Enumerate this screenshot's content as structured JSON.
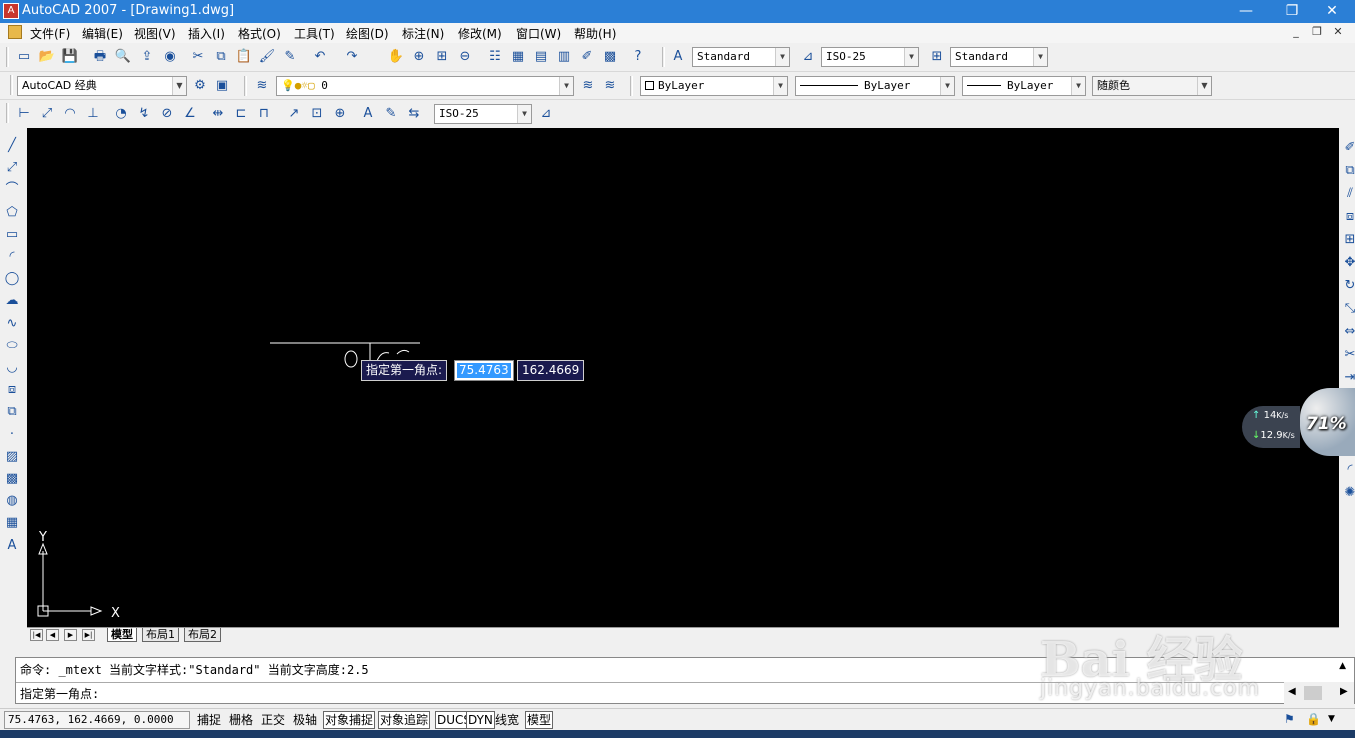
{
  "titlebar": {
    "title": "AutoCAD 2007 - [Drawing1.dwg]",
    "minimize": "—",
    "maximize": "❐",
    "close": "✕"
  },
  "menu": [
    "文件(F)",
    "编辑(E)",
    "视图(V)",
    "插入(I)",
    "格式(O)",
    "工具(T)",
    "绘图(D)",
    "标注(N)",
    "修改(M)",
    "窗口(W)",
    "帮助(H)"
  ],
  "mdi": {
    "minimize": "_",
    "restore": "❐",
    "close": "✕"
  },
  "toolbars": {
    "text_style": "Standard",
    "dim_style": "ISO-25",
    "table_style": "Standard",
    "workspace": "AutoCAD 经典",
    "layer": "0",
    "color": "ByLayer",
    "linetype": "ByLayer",
    "lineweight": "ByLayer",
    "plotstyle": "随颜色",
    "dim_style2": "ISO-25"
  },
  "icons": {
    "std": [
      "new-icon",
      "open-icon",
      "save-icon",
      "plot-icon",
      "preview-icon",
      "publish-icon",
      "3d-publish-icon",
      "cut-icon",
      "copy-icon",
      "paste-icon",
      "match-prop-icon",
      "block-edit-icon",
      "undo-icon",
      "redo-icon",
      "pan-icon",
      "zoom-realtime-icon",
      "zoom-window-icon",
      "zoom-previous-icon",
      "properties-icon",
      "design-center-icon",
      "tool-palettes-icon",
      "sheet-set-icon",
      "markup-icon",
      "calculator-icon",
      "help-icon"
    ],
    "draw": [
      "line-icon",
      "construction-line-icon",
      "polyline-icon",
      "polygon-icon",
      "rectangle-icon",
      "arc-icon",
      "circle-icon",
      "revision-cloud-icon",
      "spline-icon",
      "ellipse-icon",
      "ellipse-arc-icon",
      "insert-block-icon",
      "make-block-icon",
      "point-icon",
      "hatch-icon",
      "gradient-icon",
      "region-icon",
      "table-icon",
      "multiline-text-icon"
    ],
    "modify": [
      "erase-icon",
      "copy-object-icon",
      "mirror-icon",
      "offset-icon",
      "array-icon",
      "move-icon",
      "rotate-icon",
      "scale-icon",
      "stretch-icon",
      "trim-icon",
      "extend-icon",
      "break-icon",
      "join-icon",
      "chamfer-icon",
      "fillet-icon",
      "explode-icon"
    ]
  },
  "drawing": {
    "ucs_y": "Y",
    "ucs_x": "X",
    "dyn_prompt": "指定第一角点:",
    "dyn_x": "75.4763",
    "dyn_y": "162.4669"
  },
  "tabs": [
    "模型",
    "布局1",
    "布局2"
  ],
  "command": {
    "history": "命令: _mtext 当前文字样式:\"Standard\"  当前文字高度:2.5",
    "prompt": "指定第一角点:"
  },
  "status": {
    "coords": "75.4763,  162.4669, 0.0000",
    "buttons": [
      {
        "label": "捕捉",
        "on": false
      },
      {
        "label": "栅格",
        "on": false
      },
      {
        "label": "正交",
        "on": false
      },
      {
        "label": "极轴",
        "on": false
      },
      {
        "label": "对象捕捉",
        "on": true
      },
      {
        "label": "对象追踪",
        "on": true
      },
      {
        "label": "DUCS",
        "on": true
      },
      {
        "label": "DYN",
        "on": true
      },
      {
        "label": "线宽",
        "on": false
      },
      {
        "label": "模型",
        "on": true
      }
    ]
  },
  "net_widget": {
    "up": "14",
    "up_unit": "K/s",
    "down": "12.9",
    "down_unit": "K/s",
    "percent": "71%"
  },
  "watermark": {
    "main": "Bai 经验",
    "sub": "jingyan.baidu.com"
  }
}
